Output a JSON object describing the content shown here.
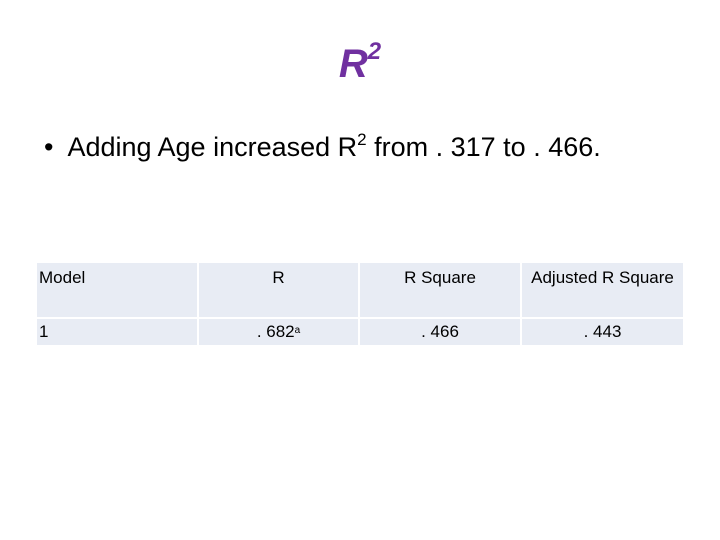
{
  "title": {
    "text": "R",
    "sup": "2",
    "color": "#7030a0"
  },
  "bullet": {
    "dot": "•",
    "before": "Adding Age increased R",
    "sup": "2",
    "after": " from . 317 to . 466."
  },
  "table": {
    "headers": [
      "Model",
      "R",
      "R Square",
      "Adjusted R Square"
    ],
    "rows": [
      {
        "model": "1",
        "r": ". 682",
        "r_footnote": "a",
        "r_square": ". 466",
        "adj_r_square": ". 443"
      }
    ],
    "cell_color": "#e8ecf4"
  }
}
